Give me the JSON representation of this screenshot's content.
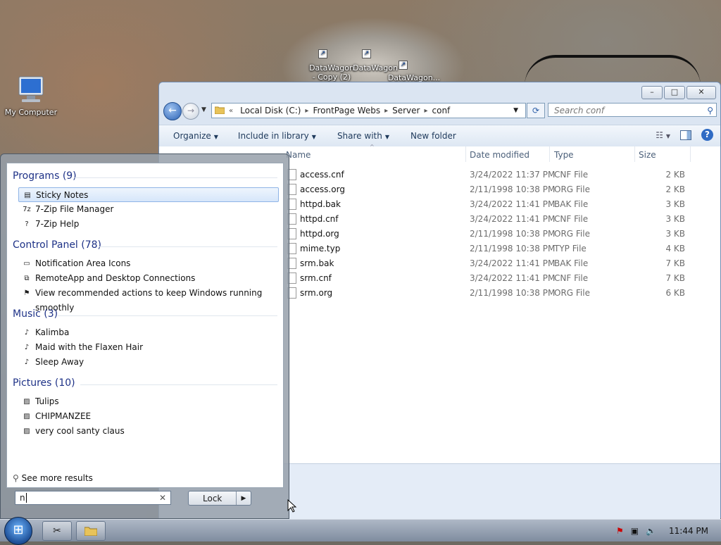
{
  "desktop": {
    "icons": [
      {
        "label": "My Computer"
      },
      {
        "label": "DataWagon - Copy (2)"
      },
      {
        "label": "DataWagon"
      },
      {
        "label": "DataWagon..."
      }
    ]
  },
  "explorer": {
    "window_controls": {
      "minimize": "–",
      "maximize": "□",
      "close": "✕"
    },
    "breadcrumb": {
      "overflow": "«",
      "parts": [
        "Local Disk (C:)",
        "FrontPage Webs",
        "Server",
        "conf"
      ],
      "separator": "▸"
    },
    "search_placeholder": "Search conf",
    "toolbar": {
      "organize": "Organize",
      "include_in_library": "Include in library",
      "share_with": "Share with",
      "new_folder": "New folder"
    },
    "columns": {
      "name": "Name",
      "date": "Date modified",
      "type": "Type",
      "size": "Size"
    },
    "files": [
      {
        "name": "access.cnf",
        "date": "3/24/2022 11:37 PM",
        "type": "CNF File",
        "size": "2 KB"
      },
      {
        "name": "access.org",
        "date": "2/11/1998 10:38 PM",
        "type": "ORG File",
        "size": "2 KB"
      },
      {
        "name": "httpd.bak",
        "date": "3/24/2022 11:41 PM",
        "type": "BAK File",
        "size": "3 KB"
      },
      {
        "name": "httpd.cnf",
        "date": "3/24/2022 11:41 PM",
        "type": "CNF File",
        "size": "3 KB"
      },
      {
        "name": "httpd.org",
        "date": "2/11/1998 10:38 PM",
        "type": "ORG File",
        "size": "3 KB"
      },
      {
        "name": "mime.typ",
        "date": "2/11/1998 10:38 PM",
        "type": "TYP File",
        "size": "4 KB"
      },
      {
        "name": "srm.bak",
        "date": "3/24/2022 11:41 PM",
        "type": "BAK File",
        "size": "7 KB"
      },
      {
        "name": "srm.cnf",
        "date": "3/24/2022 11:41 PM",
        "type": "CNF File",
        "size": "7 KB"
      },
      {
        "name": "srm.org",
        "date": "2/11/1998 10:38 PM",
        "type": "ORG File",
        "size": "6 KB"
      }
    ]
  },
  "start_menu": {
    "groups": [
      {
        "title": "Programs (9)",
        "items": [
          {
            "label": "Sticky Notes",
            "icon": "sticky-notes-icon",
            "selected": true
          },
          {
            "label": "7-Zip File Manager",
            "icon": "7zip-icon"
          },
          {
            "label": "7-Zip Help",
            "icon": "help-file-icon"
          }
        ]
      },
      {
        "title": "Control Panel (78)",
        "items": [
          {
            "label": "Notification Area Icons",
            "icon": "notification-area-icon"
          },
          {
            "label": "RemoteApp and Desktop Connections",
            "icon": "remoteapp-icon"
          },
          {
            "label": "View recommended actions to keep Windows running smoothly",
            "icon": "action-center-flag-icon"
          }
        ]
      },
      {
        "title": "Music (3)",
        "items": [
          {
            "label": "Kalimba",
            "icon": "music-file-icon"
          },
          {
            "label": "Maid with the Flaxen Hair",
            "icon": "music-file-icon"
          },
          {
            "label": "Sleep Away",
            "icon": "music-file-icon"
          }
        ]
      },
      {
        "title": "Pictures (10)",
        "items": [
          {
            "label": "Tulips",
            "icon": "picture-file-icon"
          },
          {
            "label": "CHIPMANZEE",
            "icon": "picture-file-icon"
          },
          {
            "label": "very cool santy claus",
            "icon": "picture-file-icon"
          }
        ]
      }
    ],
    "see_more": "See more results",
    "search_value": "n",
    "clear": "✕",
    "lock_button": "Lock",
    "lock_arrow": "▶"
  },
  "taskbar": {
    "start_glyph": "⊞",
    "clock": "11:44 PM"
  },
  "colors": {
    "accent": "#1e3287",
    "selection": "#d6e6fa"
  }
}
